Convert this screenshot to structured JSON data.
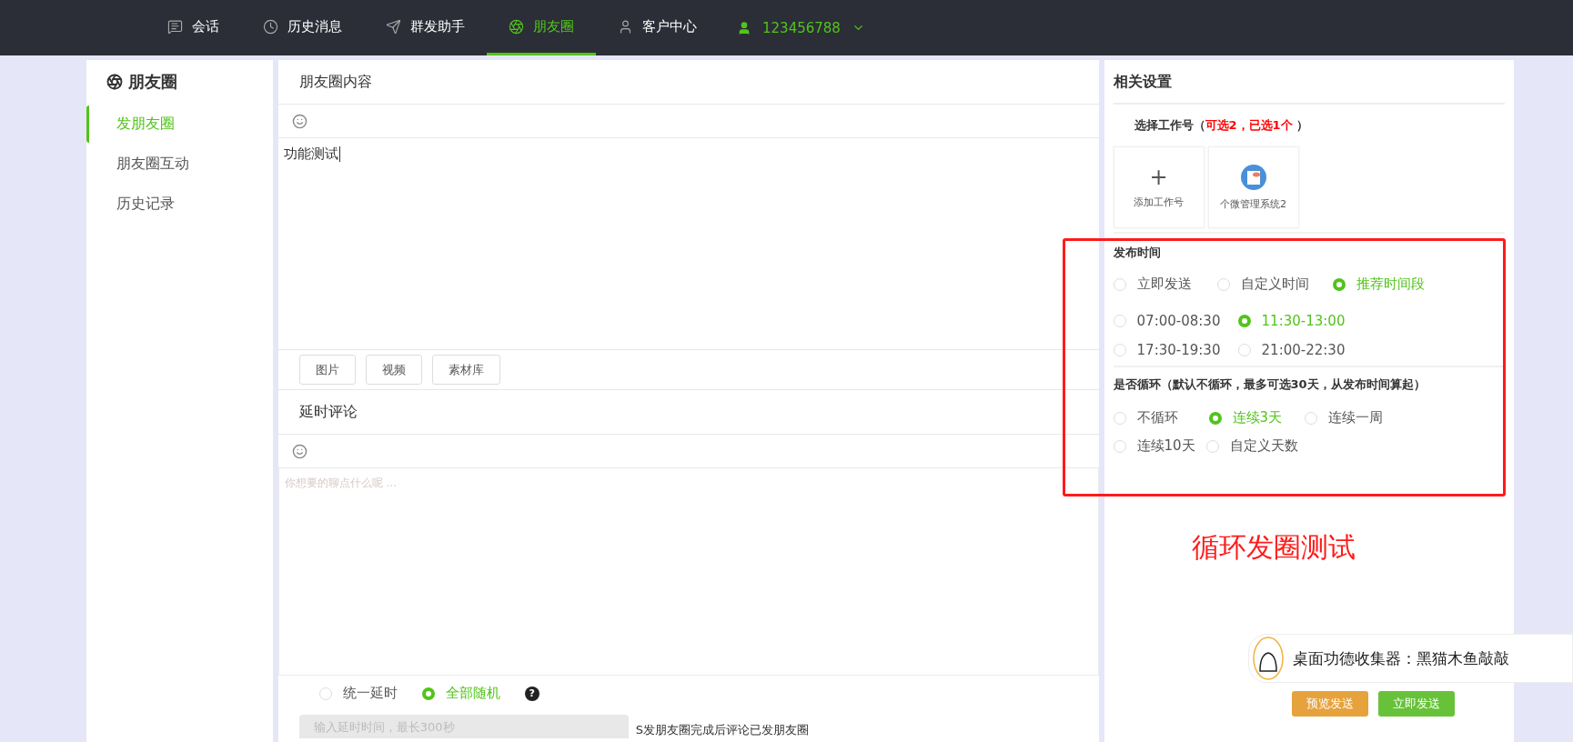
{
  "nav": {
    "items": [
      {
        "label": "会话",
        "selected": false
      },
      {
        "label": "历史消息",
        "selected": false
      },
      {
        "label": "群发助手",
        "selected": false
      },
      {
        "label": "朋友圈",
        "selected": true
      },
      {
        "label": "客户中心",
        "selected": false
      }
    ],
    "account": "123456788"
  },
  "sidebar": {
    "title": "朋友圈",
    "items": [
      {
        "label": "发朋友圈",
        "selected": true
      },
      {
        "label": "朋友圈互动",
        "selected": false
      },
      {
        "label": "历史记录",
        "selected": false
      }
    ]
  },
  "content": {
    "title": "朋友圈内容",
    "text": "功能测试",
    "buttons": [
      "图片",
      "视频",
      "素材库"
    ]
  },
  "comment": {
    "title": "延时评论",
    "placeholder": "你想要的聊点什么呢 ...",
    "delay_modes": [
      {
        "label": "统一延时",
        "selected": false
      },
      {
        "label": "全部随机",
        "selected": true
      }
    ],
    "help": "?",
    "delay_placeholder": "输入延时时间，最长300秒",
    "note": "S发朋友圈完成后评论已发朋友圈"
  },
  "settings": {
    "title": "相关设置",
    "account_label": "选择工作号（",
    "account_quota": "可选2，已选1个",
    "account_close": " ）",
    "add_account": {
      "icon": "+",
      "label": "添加工作号"
    },
    "accounts": [
      {
        "name": "个微管理系统2"
      }
    ],
    "publish_time": {
      "title": "发布时间",
      "modes": [
        {
          "label": "立即发送",
          "selected": false
        },
        {
          "label": "自定义时间",
          "selected": false
        },
        {
          "label": "推荐时间段",
          "selected": true
        }
      ],
      "slots": [
        {
          "label": "07:00-08:30",
          "selected": false
        },
        {
          "label": "11:30-13:00",
          "selected": true
        },
        {
          "label": "17:30-19:30",
          "selected": false
        },
        {
          "label": "21:00-22:30",
          "selected": false
        }
      ]
    },
    "loop": {
      "title": "是否循环（默认不循环，最多可选30天，从发布时间算起）",
      "options": [
        {
          "label": "不循环",
          "selected": false
        },
        {
          "label": "连续3天",
          "selected": true
        },
        {
          "label": "连续一周",
          "selected": false
        },
        {
          "label": "连续10天",
          "selected": false
        },
        {
          "label": "自定义天数",
          "selected": false
        }
      ]
    },
    "buttons": [
      {
        "label": "预览发送",
        "kind": "preview"
      },
      {
        "label": "立即发送",
        "kind": "send"
      }
    ]
  },
  "annotation": {
    "text": "循环发圈测试"
  },
  "popup": {
    "text": "桌面功德收集器：黑猫木鱼敲敲"
  }
}
